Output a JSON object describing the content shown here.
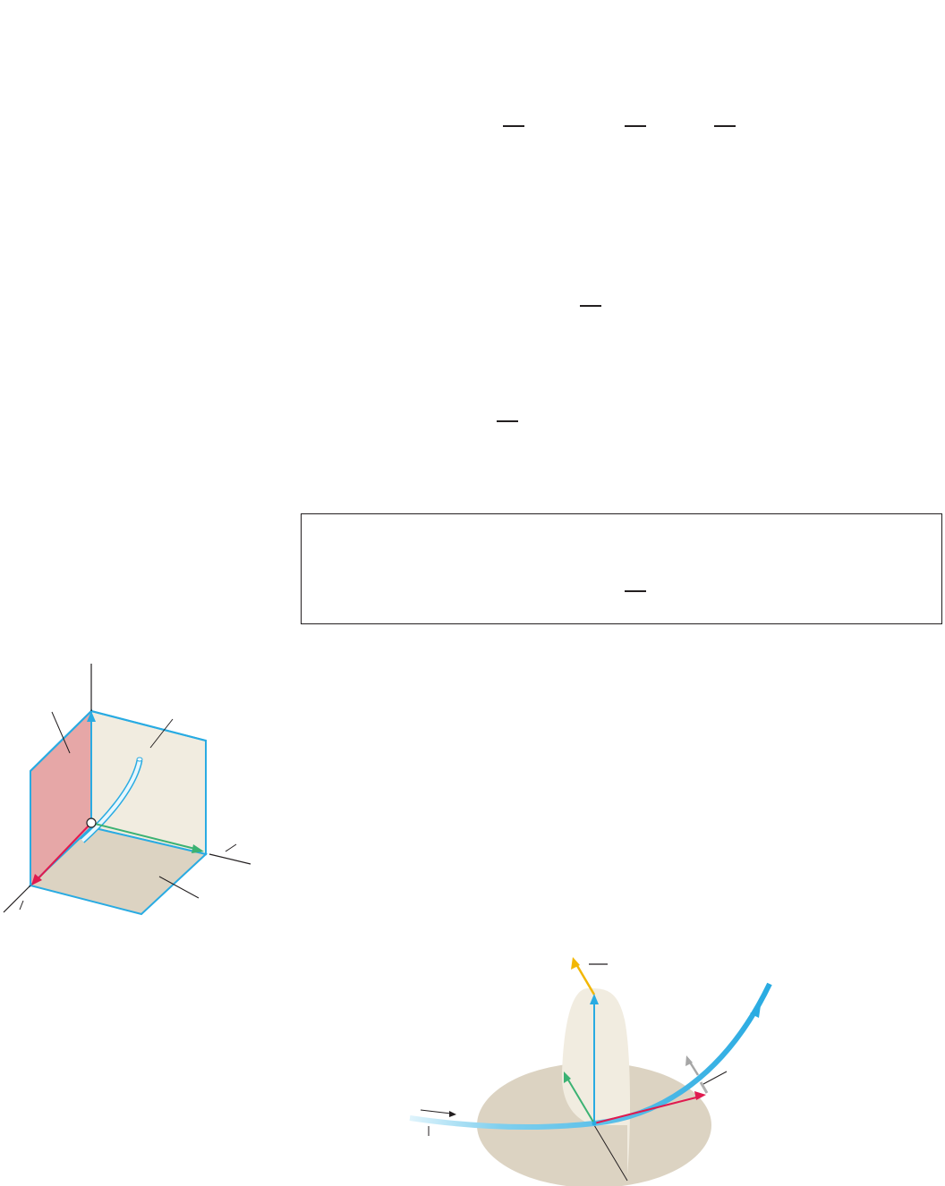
{
  "colors": {
    "ink": "#231f20",
    "curve_blue": "#29abe2",
    "light_blue": "#9ad8f2",
    "unit_red": "#e01a4f",
    "unit_green": "#3bb273",
    "unit_yellow": "#f2b705",
    "arrow_gray": "#a6a6a6",
    "plane_pink": "#e6a7a7",
    "plane_cream": "#f1ece0",
    "plane_tan": "#dcd3c2"
  },
  "equations": {
    "fraction_bars": 6,
    "boxed_formula_fraction_bars": 1
  },
  "figure_frame": {
    "description_icons": [
      "osculating-plane",
      "normal-plane",
      "rectifying-plane",
      "space-curve",
      "tangent-vector",
      "normal-vector",
      "binormal-vector"
    ]
  },
  "figure_moving_frame": {
    "icons": [
      "space-curve",
      "tangent-vector",
      "normal-vector",
      "binormal-vector",
      "curvature-vector",
      "osculating-disc",
      "normal-plane"
    ]
  }
}
